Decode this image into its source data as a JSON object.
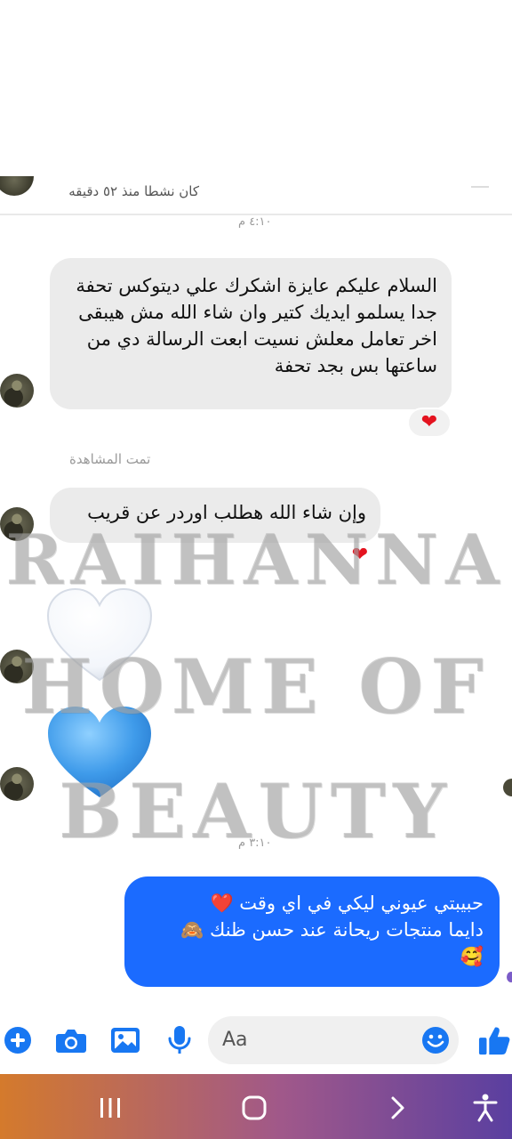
{
  "header": {
    "status_text": "كان نشطا منذ ٥٢ دقيقه"
  },
  "timestamps": {
    "first": "٤:١٠ م",
    "second": "٣:١٠ م"
  },
  "messages": {
    "incoming_1": "السلام عليكم عايزة اشكرك علي ديتوكس تحفة جدا يسلمو ايديك كتير وان شاء الله مش هيبقى اخر تعامل معلش نسيت ابعت الرسالة دي من ساعتها بس بجد تحفة",
    "seen_label": "تمت المشاهدة",
    "incoming_2": "وإن شاء الله هطلب اوردر عن قريب",
    "outgoing_line1": "حبيبتي عيوني ليكي في اي وقت ❤️",
    "outgoing_line2": "دايما منتجات ريحانة عند حسن ظنك 🙈",
    "outgoing_line3": "🥰"
  },
  "reactions": {
    "message_1": "heart-red",
    "message_2": "heart-red"
  },
  "stickers": [
    "white-heart",
    "blue-heart"
  ],
  "watermark": {
    "line1": "RAIHANNA",
    "line2": "HOME OF",
    "line3": "BEAUTY"
  },
  "composer": {
    "placeholder": "Aa",
    "icons": [
      "plus-icon",
      "camera-icon",
      "gallery-icon",
      "microphone-icon",
      "emoji-icon",
      "thumbs-up-icon"
    ]
  },
  "navbar": {
    "icons": [
      "recent-apps-icon",
      "home-icon",
      "back-icon",
      "accessibility-icon"
    ]
  },
  "colors": {
    "outgoing_bubble": "#1b6bff",
    "incoming_bubble": "#ebebeb",
    "messenger_blue": "#1877f2",
    "heart_red": "#e4131f"
  }
}
